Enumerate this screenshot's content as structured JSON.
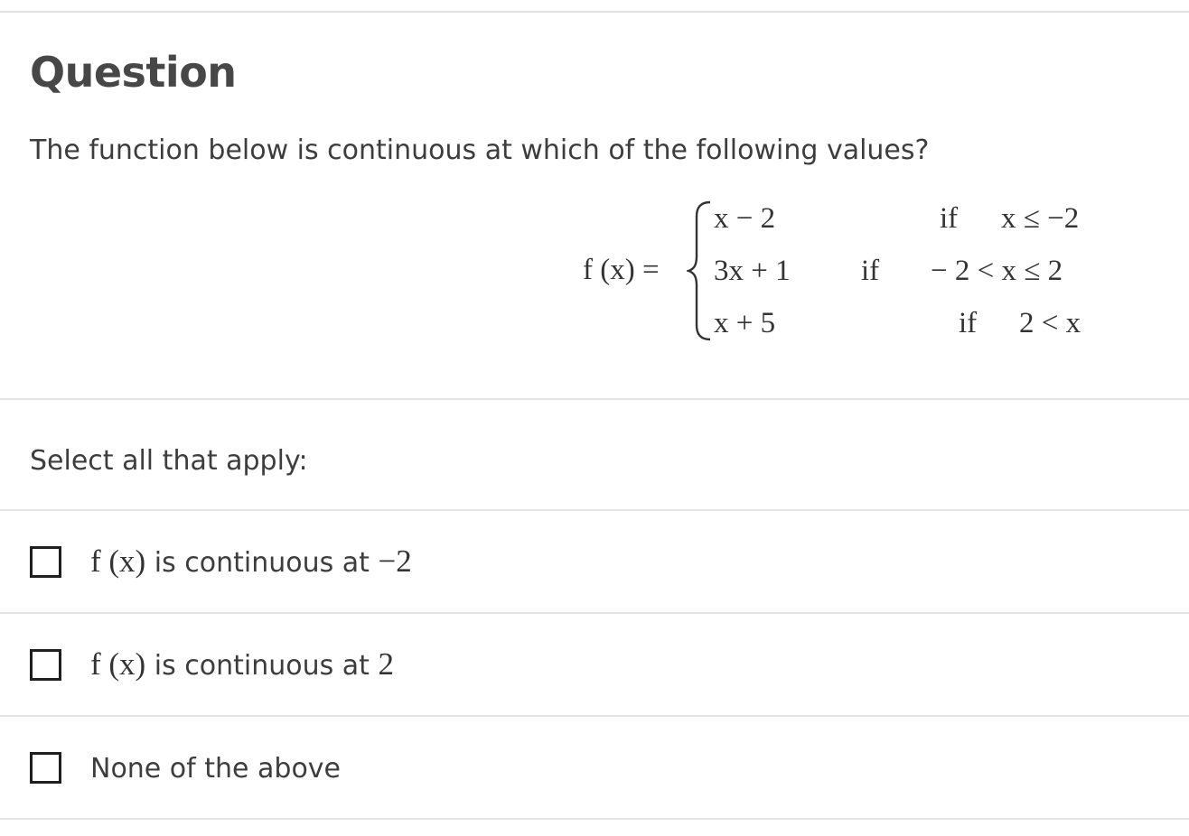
{
  "question": {
    "title": "Question",
    "prompt": "The function below is continuous at which of the following values?"
  },
  "formula": {
    "lhs": "f (x) =",
    "pieces": [
      {
        "expr": "x − 2",
        "if_label": "if",
        "condition": "x ≤ −2"
      },
      {
        "expr": "3x + 1",
        "if_label": "if",
        "condition": "− 2 < x ≤ 2"
      },
      {
        "expr": "x + 5",
        "if_label": "if",
        "condition": "2 < x"
      }
    ]
  },
  "answers": {
    "instruction": "Select all that apply:",
    "options": [
      {
        "math_prefix": "f (x)",
        "text": " is continuous at ",
        "math_value": "−2",
        "checked": false
      },
      {
        "math_prefix": "f (x)",
        "text": " is continuous at ",
        "math_value": "2",
        "checked": false
      },
      {
        "math_prefix": "",
        "text": "None of the above",
        "math_value": "",
        "checked": false
      }
    ]
  }
}
